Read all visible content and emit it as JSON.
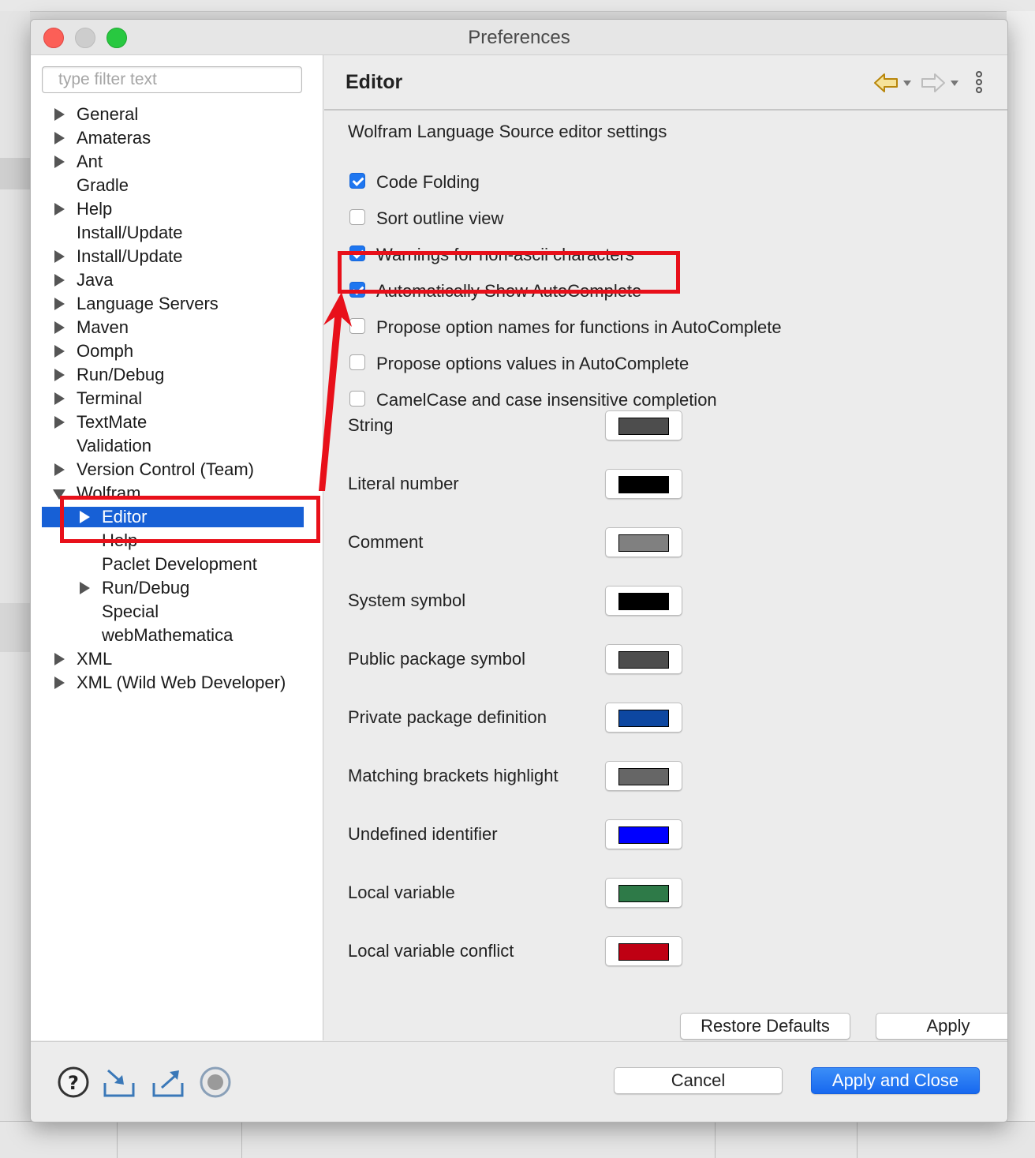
{
  "window": {
    "title": "Preferences"
  },
  "filter": {
    "placeholder": "type filter text"
  },
  "tree": [
    {
      "label": "General",
      "expand": "collapsed"
    },
    {
      "label": "Amateras",
      "expand": "collapsed"
    },
    {
      "label": "Ant",
      "expand": "collapsed"
    },
    {
      "label": "Gradle",
      "expand": "none"
    },
    {
      "label": "Help",
      "expand": "collapsed"
    },
    {
      "label": "Install/Update",
      "expand": "none"
    },
    {
      "label": "Install/Update",
      "expand": "collapsed"
    },
    {
      "label": "Java",
      "expand": "collapsed"
    },
    {
      "label": "Language Servers",
      "expand": "collapsed"
    },
    {
      "label": "Maven",
      "expand": "collapsed"
    },
    {
      "label": "Oomph",
      "expand": "collapsed"
    },
    {
      "label": "Run/Debug",
      "expand": "collapsed"
    },
    {
      "label": "Terminal",
      "expand": "collapsed"
    },
    {
      "label": "TextMate",
      "expand": "collapsed"
    },
    {
      "label": "Validation",
      "expand": "none"
    },
    {
      "label": "Version Control (Team)",
      "expand": "collapsed"
    },
    {
      "label": "Wolfram",
      "expand": "expanded"
    },
    {
      "label": "Editor",
      "expand": "collapsed",
      "child": true,
      "selected": true
    },
    {
      "label": "Help",
      "expand": "none",
      "child": true
    },
    {
      "label": "Paclet Development",
      "expand": "none",
      "child": true
    },
    {
      "label": "Run/Debug",
      "expand": "collapsed",
      "child": true
    },
    {
      "label": "Special",
      "expand": "none",
      "child": true
    },
    {
      "label": "webMathematica",
      "expand": "none",
      "child": true
    },
    {
      "label": "XML",
      "expand": "collapsed"
    },
    {
      "label": "XML (Wild Web Developer)",
      "expand": "collapsed"
    }
  ],
  "page": {
    "title": "Editor",
    "nav_icons": [
      "back-arrow-icon",
      "forward-arrow-icon",
      "view-menu-icon"
    ],
    "settings_title": "Wolfram Language Source editor settings",
    "checkboxes": [
      {
        "label": "Code Folding",
        "checked": true
      },
      {
        "label": "Sort outline view",
        "checked": false
      },
      {
        "label": "Warnings for non-ascii characters",
        "checked": true
      },
      {
        "label": "Automatically Show AutoComplete",
        "checked": true
      },
      {
        "label": "Propose option names for functions in AutoComplete",
        "checked": false
      },
      {
        "label": "Propose options values in AutoComplete",
        "checked": false
      },
      {
        "label": "CamelCase and case insensitive completion",
        "checked": false
      }
    ],
    "colors": [
      {
        "label": "String",
        "color": "#4d4d4d"
      },
      {
        "label": "Literal number",
        "color": "#000000"
      },
      {
        "label": "Comment",
        "color": "#808080"
      },
      {
        "label": "System symbol",
        "color": "#000000"
      },
      {
        "label": "Public package symbol",
        "color": "#4d4d4d"
      },
      {
        "label": "Private package definition",
        "color": "#0d47a1"
      },
      {
        "label": "Matching brackets highlight",
        "color": "#666666"
      },
      {
        "label": "Undefined identifier",
        "color": "#0000ff"
      },
      {
        "label": "Local variable",
        "color": "#2e7a48"
      },
      {
        "label": "Local variable conflict",
        "color": "#bf0013"
      }
    ],
    "restore_label": "Restore Defaults",
    "apply_label": "Apply"
  },
  "footer": {
    "icons": [
      "help-icon",
      "import-icon",
      "export-icon",
      "record-icon"
    ],
    "cancel_label": "Cancel",
    "apply_close_label": "Apply and Close"
  },
  "colors": {
    "selection": "#1760d6",
    "annotation": "#e8101a",
    "primary_button": "#1768ef"
  }
}
